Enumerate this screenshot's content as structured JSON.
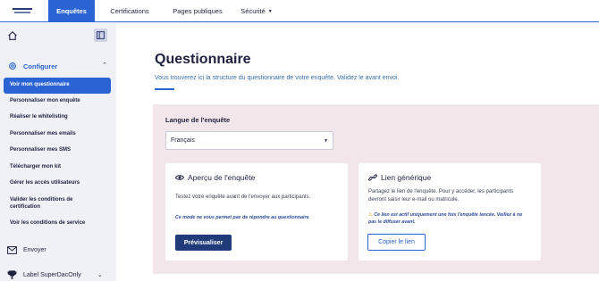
{
  "topnav": {
    "tabs": [
      {
        "label": "Enquêtes"
      },
      {
        "label": "Certifications"
      },
      {
        "label": "Pages publiques"
      },
      {
        "label": "Sécurité"
      }
    ]
  },
  "sidebar": {
    "section_title": "Configurer",
    "items": [
      {
        "label": "Voir mon questionnaire"
      },
      {
        "label": "Personnaliser mon enquête"
      },
      {
        "label": "Réaliser le whitelisting"
      },
      {
        "label": "Personnaliser mes emails"
      },
      {
        "label": "Personnaliser mes SMS"
      },
      {
        "label": "Télécharger mon kit"
      },
      {
        "label": "Gérer les accès utilisateurs"
      },
      {
        "label": "Valider les conditions de certification"
      },
      {
        "label": "Voir les conditions de service"
      }
    ],
    "send_label": "Envoyer",
    "label_label": "Label SuperDacOnly"
  },
  "main": {
    "title": "Questionnaire",
    "subtitle": "Vous trouverez ici la structure du questionnaire de votre enquête. Validez le avant envoi.",
    "language_label": "Langue de l'enquête",
    "language_value": "Français",
    "preview_card": {
      "title": "Aperçu de l'enquête",
      "text": "Testez votre enquête avant de l'envoyer aux participants.",
      "note": "Ce mode ne vous permet pas de répondre au questionnaire",
      "button": "Prévisualiser"
    },
    "link_card": {
      "title": "Lien générique",
      "text": "Partagez le lien de l'enquête. Pour y accéder, les participants devront saisir leur e-mail ou matricule.",
      "warning": "Ce lien est actif uniquement une fois l'enquête lancée. Veillez à ne pas le diffuser avant.",
      "button": "Copier le lien"
    }
  },
  "colors": {
    "accent": "#2a63d4",
    "sidebar_bg": "#f0f1f6",
    "panel_bg": "#f3e6ea",
    "primary_button": "#213a7a"
  }
}
